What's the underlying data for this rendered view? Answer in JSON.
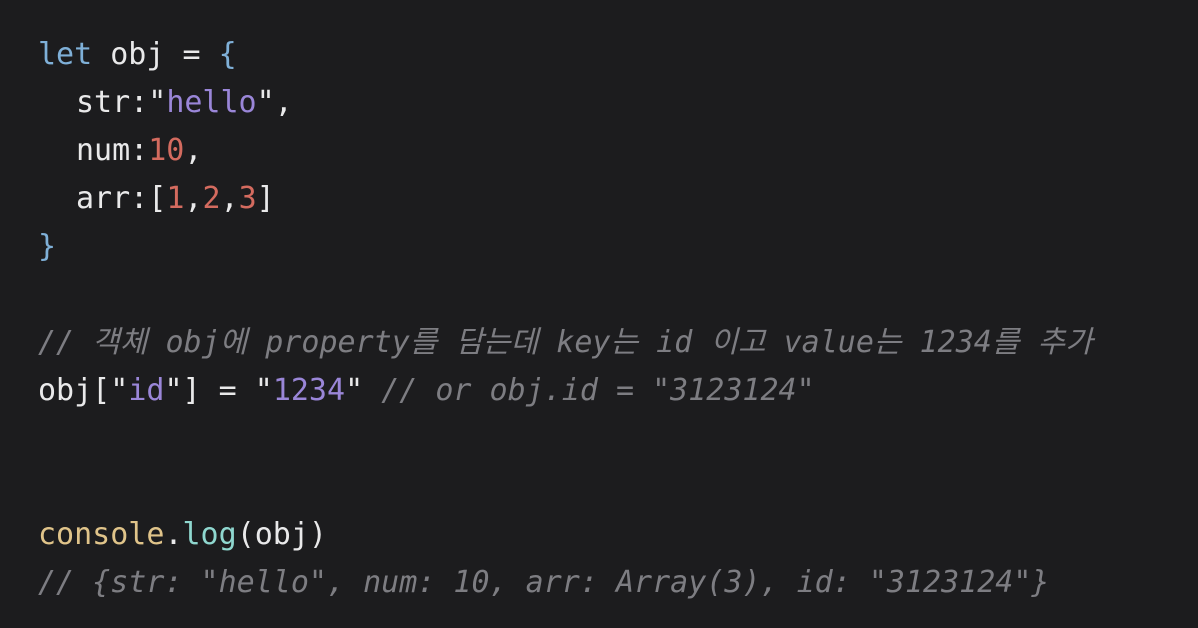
{
  "code": {
    "l1": {
      "kw": "let",
      "rest": " obj = ",
      "brace": "{"
    },
    "l2": {
      "key": "str:",
      "q1": "\"",
      "val": "hello",
      "q2": "\",",
      "tail": ""
    },
    "l3": {
      "key": "num:",
      "val": "10",
      "tail": ","
    },
    "l4": {
      "key": "arr:[",
      "n1": "1",
      "c1": ",",
      "n2": "2",
      "c2": ",",
      "n3": "3",
      "tail": "]"
    },
    "l5": {
      "brace": "}"
    },
    "l7": {
      "comment": "// 객체 obj에 property를 담는데 key는 id 이고 value는 1234를 추가"
    },
    "l8": {
      "p1": "obj[\"",
      "key": "id",
      "p2": "\"] = \"",
      "val": "1234",
      "p3": "\" ",
      "comment": "// or obj.id = \"3123124\""
    },
    "l11": {
      "obj": "console",
      "dot": ".",
      "fn": "log",
      "args": "(obj)"
    },
    "l12": {
      "comment": "// {str: \"hello\", num: 10, arr: Array(3), id: \"3123124\"}"
    }
  }
}
